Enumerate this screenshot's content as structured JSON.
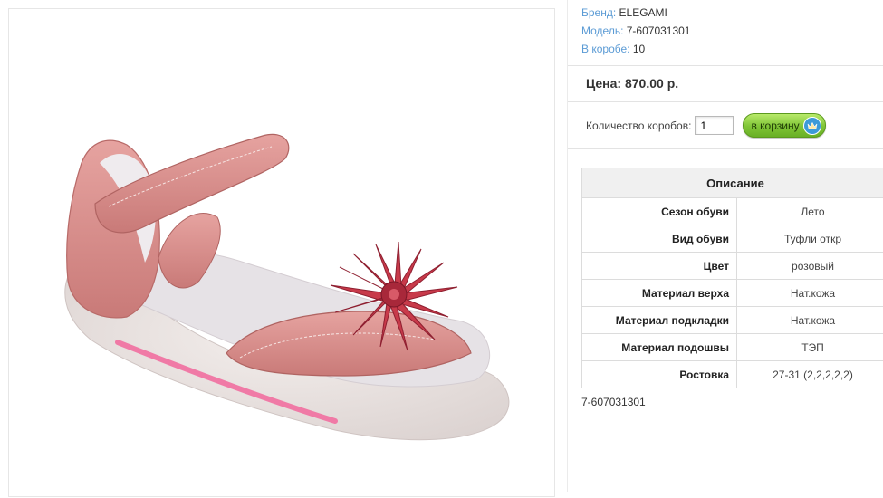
{
  "product": {
    "image_alt": "Детская сандалия розовая с цветком"
  },
  "meta": {
    "brand_label": "Бренд:",
    "brand_value": "ELEGAMI",
    "model_label": "Модель:",
    "model_value": "7-607031301",
    "box_label": "В коробе:",
    "box_value": "10"
  },
  "price": {
    "text": "Цена: 870.00 р."
  },
  "order": {
    "qty_label": "Количество коробов:",
    "qty_value": "1",
    "cart_button": "в корзину",
    "cart_icon": "crown-cart-icon"
  },
  "specs": {
    "header": "Описание",
    "rows": [
      {
        "name": "Сезон обуви",
        "value": "Лето"
      },
      {
        "name": "Вид обуви",
        "value": "Туфли откр"
      },
      {
        "name": "Цвет",
        "value": "розовый"
      },
      {
        "name": "Материал верха",
        "value": "Нат.кожа"
      },
      {
        "name": "Материал подкладки",
        "value": "Нат.кожа"
      },
      {
        "name": "Материал подошвы",
        "value": "ТЭП"
      },
      {
        "name": "Ростовка",
        "value": "27-31 (2,2,2,2,2)"
      }
    ]
  },
  "footer": {
    "model_code": "7-607031301"
  },
  "colors": {
    "link_blue": "#5b9bd5",
    "button_green": "#7fc436",
    "shoe_pink": "#d98c8a",
    "flower_red": "#c83a4a"
  }
}
